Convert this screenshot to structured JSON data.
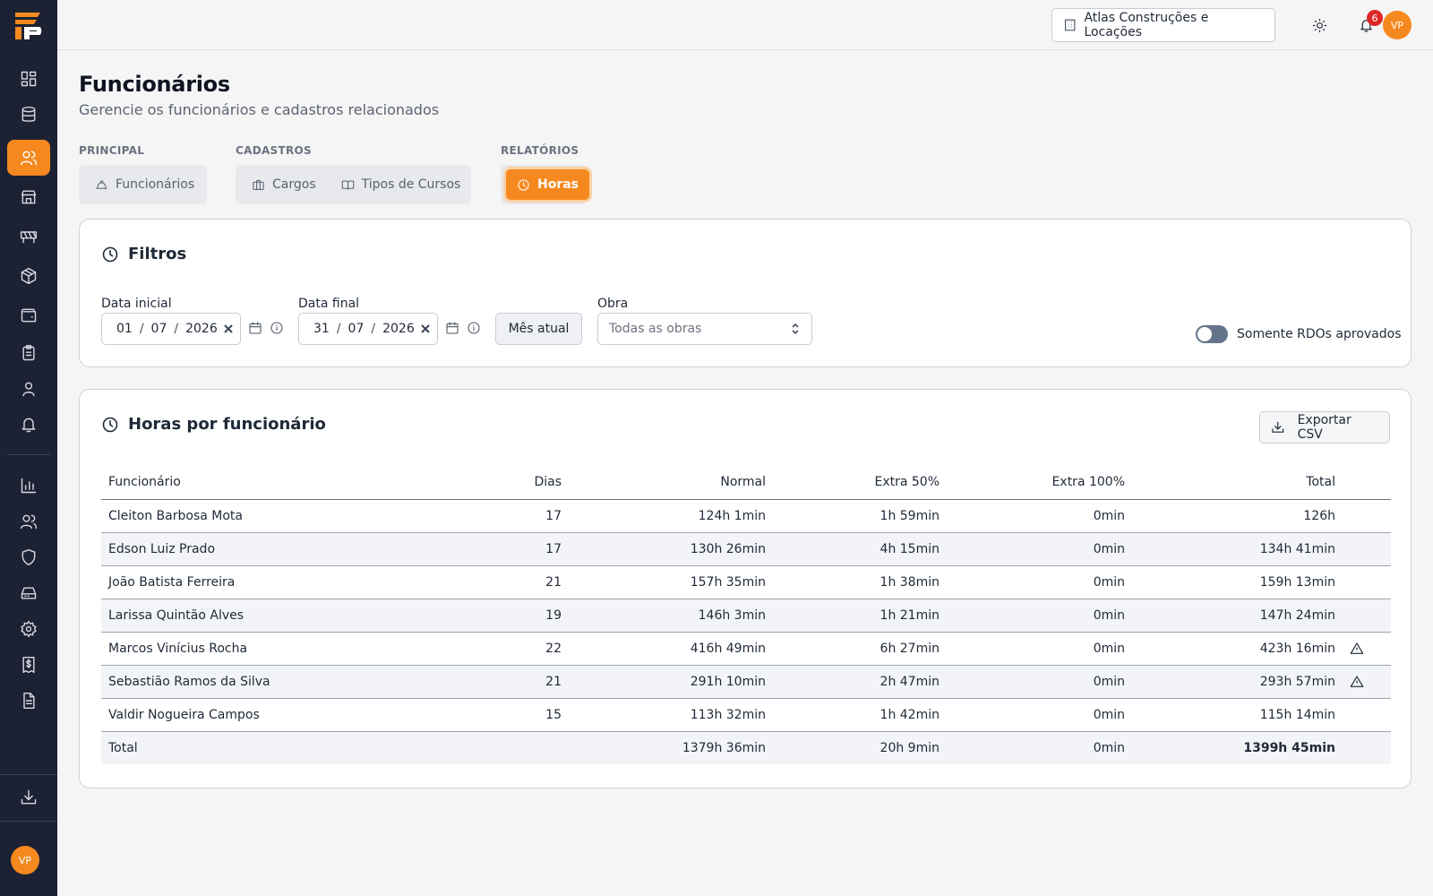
{
  "user": {
    "initials": "VP"
  },
  "topbar": {
    "company": "Atlas Construções e Locações",
    "notifications": "6"
  },
  "page": {
    "title": "Funcionários",
    "subtitle": "Gerencie os funcionários e cadastros relacionados"
  },
  "tab_groups": {
    "principal": {
      "label": "PRINCIPAL",
      "tabs": [
        "Funcionários"
      ]
    },
    "cadastros": {
      "label": "CADASTROS",
      "tabs": [
        "Cargos",
        "Tipos de Cursos"
      ]
    },
    "relatorios": {
      "label": "RELATÓRIOS",
      "tabs": [
        "Horas"
      ]
    }
  },
  "filters": {
    "title": "Filtros",
    "start": {
      "label": "Data inicial",
      "day": "01",
      "month": "07",
      "year": "2026"
    },
    "end": {
      "label": "Data final",
      "day": "31",
      "month": "07",
      "year": "2026"
    },
    "current_month_button": "Mês atual",
    "obra": {
      "label": "Obra",
      "value": "Todas as obras"
    },
    "approved_only": {
      "label": "Somente RDOs aprovados",
      "on": false
    }
  },
  "hours": {
    "title": "Horas por funcionário",
    "export_button": "Exportar CSV",
    "columns": [
      "Funcionário",
      "Dias",
      "Normal",
      "Extra 50%",
      "Extra 100%",
      "Total"
    ],
    "rows": [
      {
        "name": "Cleiton Barbosa Mota",
        "dias": "17",
        "normal": "124h 1min",
        "extra50": "1h 59min",
        "extra100": "0min",
        "total": "126h",
        "warning": false
      },
      {
        "name": "Edson Luiz Prado",
        "dias": "17",
        "normal": "130h 26min",
        "extra50": "4h 15min",
        "extra100": "0min",
        "total": "134h 41min",
        "warning": false
      },
      {
        "name": "João Batista Ferreira",
        "dias": "21",
        "normal": "157h 35min",
        "extra50": "1h 38min",
        "extra100": "0min",
        "total": "159h 13min",
        "warning": false
      },
      {
        "name": "Larissa Quintão Alves",
        "dias": "19",
        "normal": "146h 3min",
        "extra50": "1h 21min",
        "extra100": "0min",
        "total": "147h 24min",
        "warning": false
      },
      {
        "name": "Marcos Vinícius Rocha",
        "dias": "22",
        "normal": "416h 49min",
        "extra50": "6h 27min",
        "extra100": "0min",
        "total": "423h 16min",
        "warning": true
      },
      {
        "name": "Sebastião Ramos da Silva",
        "dias": "21",
        "normal": "291h 10min",
        "extra50": "2h 47min",
        "extra100": "0min",
        "total": "293h 57min",
        "warning": true
      },
      {
        "name": "Valdir Nogueira Campos",
        "dias": "15",
        "normal": "113h 32min",
        "extra50": "1h 42min",
        "extra100": "0min",
        "total": "115h 14min",
        "warning": false
      }
    ],
    "totals": {
      "label": "Total",
      "normal": "1379h 36min",
      "extra50": "20h 9min",
      "extra100": "0min",
      "total": "1399h 45min"
    }
  },
  "colors": {
    "accent": "#f5891f",
    "sidebar": "#1c2233",
    "badge": "#dc2626"
  }
}
